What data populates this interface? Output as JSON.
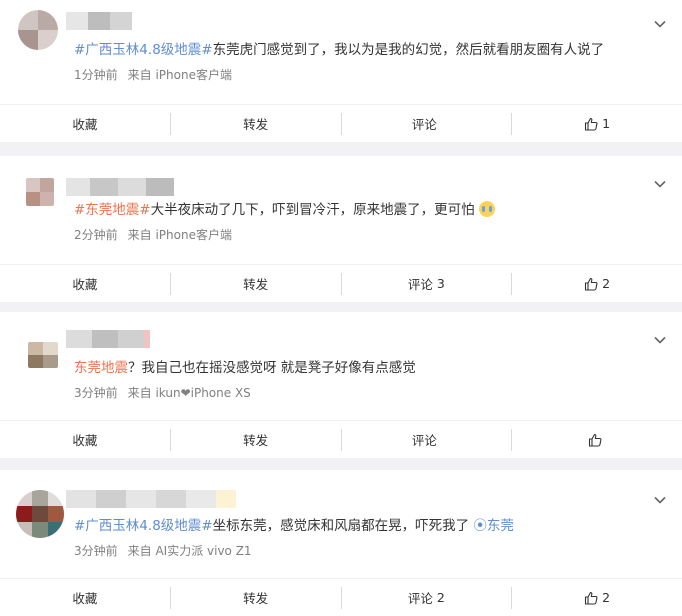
{
  "posts": [
    {
      "text": [
        {
          "t": "#广西玉林4.8级地震#",
          "cls": "topic-blue"
        },
        {
          "t": "东莞虎门感觉到了，我以为是我的幻觉，然后就看朋友圈有人说了",
          "cls": ""
        }
      ],
      "time": "1分钟前",
      "source": "来自 iPhone客户端",
      "actions": {
        "fav": "收藏",
        "repost": "转发",
        "comment": "评论",
        "comment_count": "",
        "like_count": "1"
      }
    },
    {
      "text": [
        {
          "t": "#东莞地震#",
          "cls": "topic"
        },
        {
          "t": "大半夜床动了几下，吓到冒冷汗，原来地震了，更可怕",
          "cls": ""
        }
      ],
      "emoji": "crying-face",
      "time": "2分钟前",
      "source": "来自 iPhone客户端",
      "actions": {
        "fav": "收藏",
        "repost": "转发",
        "comment": "评论",
        "comment_count": "3",
        "like_count": "2"
      }
    },
    {
      "text": [
        {
          "t": "东莞地震",
          "cls": "topic"
        },
        {
          "t": "？我自己也在摇没感觉呀 就是凳子好像有点感觉",
          "cls": ""
        }
      ],
      "time": "3分钟前",
      "source": "来自 ikun❤iPhone XS",
      "actions": {
        "fav": "收藏",
        "repost": "转发",
        "comment": "评论",
        "comment_count": "",
        "like_count": ""
      }
    },
    {
      "text": [
        {
          "t": "#广西玉林4.8级地震#",
          "cls": "topic-blue"
        },
        {
          "t": "坐标东莞，感觉床和风扇都在晃，吓死我了 ",
          "cls": ""
        },
        {
          "t": "⦿东莞",
          "cls": "topic-blue"
        }
      ],
      "time": "3分钟前",
      "source": "来自 AI实力派 vivo Z1",
      "actions": {
        "fav": "收藏",
        "repost": "转发",
        "comment": "评论",
        "comment_count": "2",
        "like_count": "2"
      }
    }
  ],
  "colors": {
    "topic_orange": "#eb7350",
    "topic_blue": "#5f8dd3",
    "meta_gray": "#808080"
  },
  "icons": {
    "more": "chevron-down-icon",
    "like": "thumbs-up-icon"
  }
}
